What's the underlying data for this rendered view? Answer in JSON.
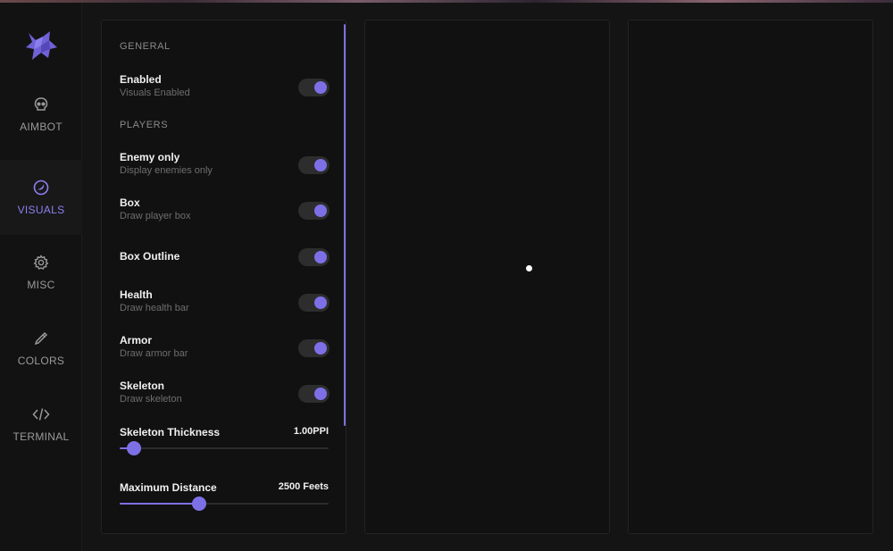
{
  "colors": {
    "accent": "#7d70e6",
    "background": "#141414",
    "panel": "#111111"
  },
  "logo": {
    "icon": "wolf-logo-icon"
  },
  "nav": {
    "items": [
      {
        "label": "AIMBOT",
        "icon": "skull-icon",
        "active": false
      },
      {
        "label": "VISUALS",
        "icon": "eye-icon",
        "active": true
      },
      {
        "label": "MISC",
        "icon": "gear-icon",
        "active": false
      },
      {
        "label": "COLORS",
        "icon": "eyedropper-icon",
        "active": false
      },
      {
        "label": "TERMINAL",
        "icon": "code-icon",
        "active": false
      }
    ]
  },
  "visuals": {
    "general_title": "GENERAL",
    "players_title": "PLAYERS",
    "enabled": {
      "title": "Enabled",
      "desc": "Visuals Enabled",
      "on": true
    },
    "enemy_only": {
      "title": "Enemy only",
      "desc": "Display enemies only",
      "on": true
    },
    "box": {
      "title": "Box",
      "desc": "Draw player box",
      "on": true
    },
    "box_outline": {
      "title": "Box Outline",
      "on": true
    },
    "health": {
      "title": "Health",
      "desc": "Draw health bar",
      "on": true
    },
    "armor": {
      "title": "Armor",
      "desc": "Draw armor bar",
      "on": true
    },
    "skeleton": {
      "title": "Skeleton",
      "desc": "Draw skeleton",
      "on": true
    },
    "skeleton_thickness": {
      "title": "Skeleton Thickness",
      "value": "1.00PPI",
      "fraction": 0.07
    },
    "max_distance": {
      "title": "Maximum Distance",
      "value": "2500 Feets",
      "fraction": 0.38
    }
  }
}
